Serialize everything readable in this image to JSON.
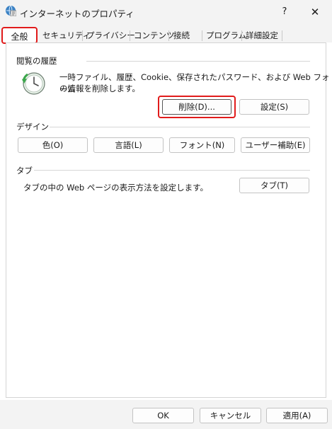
{
  "window": {
    "title": "インターネットのプロパティ",
    "help_glyph": "?",
    "close_glyph": "✕"
  },
  "tabs": [
    {
      "label": "全般",
      "active": true
    },
    {
      "label": "セキュリティ"
    },
    {
      "label": "プライバシー"
    },
    {
      "label": "コンテンツ"
    },
    {
      "label": "接続"
    },
    {
      "label": "プログラム"
    },
    {
      "label": "詳細設定"
    }
  ],
  "history": {
    "group_label": "閲覧の履歴",
    "description_line1": "一時ファイル、履歴、Cookie、保存されたパスワード、および Web フォーム",
    "description_line2": "の情報を削除します。",
    "delete_label": "削除(D)...",
    "settings_label": "設定(S)"
  },
  "design": {
    "group_label": "デザイン",
    "color_label": "色(O)",
    "language_label": "言語(L)",
    "font_label": "フォント(N)",
    "accessibility_label": "ユーザー補助(E)"
  },
  "tabs_group": {
    "group_label": "タブ",
    "description": "タブの中の Web ページの表示方法を設定します。",
    "tabs_button_label": "タブ(T)"
  },
  "footer": {
    "ok_label": "OK",
    "cancel_label": "キャンセル",
    "apply_label": "適用(A)"
  },
  "colors": {
    "highlight": "#e11b1b",
    "background": "#f3f3f3"
  },
  "icons": [
    "internet-options-icon",
    "history-clock-icon"
  ]
}
